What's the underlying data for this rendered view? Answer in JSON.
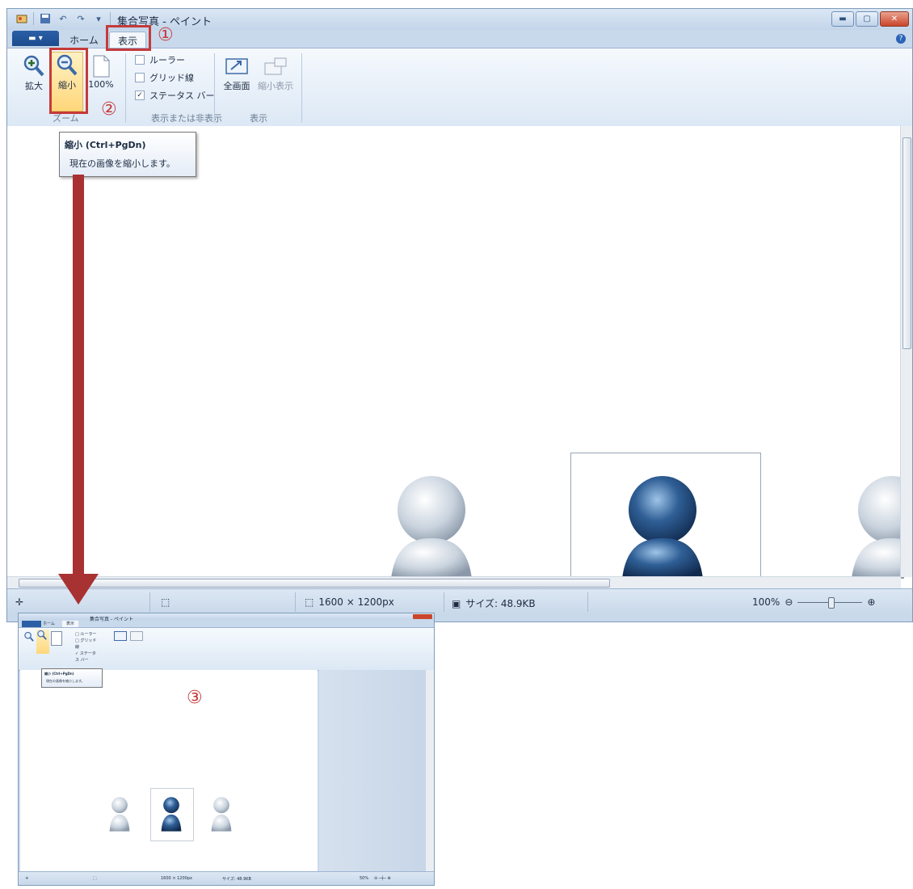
{
  "main": {
    "title": "集合写真 - ペイント",
    "tabs": [
      {
        "label": "ホーム",
        "active": false
      },
      {
        "label": "表示",
        "active": true
      }
    ],
    "zoom_group": {
      "zoom_in": "拡大",
      "zoom_out": "縮小",
      "actual_size": "100%",
      "label": "ズーム"
    },
    "show_hide_group": {
      "ruler": "ルーラー",
      "gridlines": "グリッド線",
      "statusbar": "ステータス バー",
      "statusbar_checked": true,
      "label": "表示または非表示"
    },
    "display_group": {
      "fullscreen": "全画面",
      "thumbnail": "縮小表示",
      "label": "表示"
    },
    "tooltip": {
      "title": "縮小 (Ctrl+PgDn)",
      "description": "現在の画像を縮小します。"
    },
    "status": {
      "dimensions": "1600 × 1200px",
      "size": "サイズ: 48.9KB",
      "zoom": "100%"
    }
  },
  "annotations": {
    "step1": "①",
    "step2": "②",
    "step3": "③"
  },
  "result": {
    "title": "集合写真 - ペイント",
    "tooltip_title": "縮小 (Ctrl+PgDn)",
    "tooltip_description": "現在の画像を縮小します。",
    "status_dimensions": "1600 × 1200px",
    "status_size": "サイズ: 48.9KB",
    "status_zoom": "50%"
  },
  "colors": {
    "annotation_red": "#c53a3a",
    "arrow_red": "#a83232",
    "ribbon_blue": "#c9d9ec",
    "highlight_orange": "#ffd77a"
  }
}
